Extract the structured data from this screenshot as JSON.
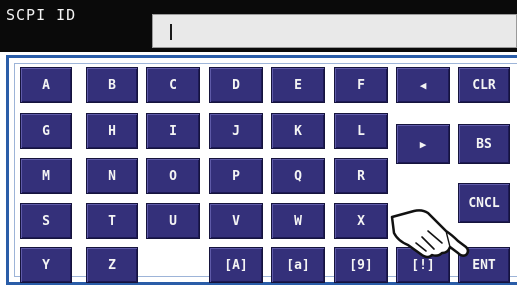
{
  "field": {
    "label": "SCPI ID",
    "value": ""
  },
  "keys": {
    "row1": [
      "A",
      "B",
      "C",
      "D",
      "E",
      "F"
    ],
    "row2": [
      "G",
      "H",
      "I",
      "J",
      "K",
      "L"
    ],
    "row3": [
      "M",
      "N",
      "O",
      "P",
      "Q",
      "R"
    ],
    "row4": [
      "S",
      "T",
      "U",
      "V",
      "W",
      "X"
    ],
    "row5": [
      "Y",
      "Z",
      "[A]",
      "[a]",
      "[9]",
      "[!]"
    ],
    "left_glyph": "◀",
    "right_glyph": "▶",
    "clr": "CLR",
    "bs": "BS",
    "cncl": "CNCL",
    "ent": "ENT"
  },
  "icons": {
    "pointer": "pointing-hand-icon"
  },
  "colors": {
    "key_bg": "#34307a",
    "panel_border": "#2a5da8",
    "top_bg": "#0a0a0a"
  }
}
